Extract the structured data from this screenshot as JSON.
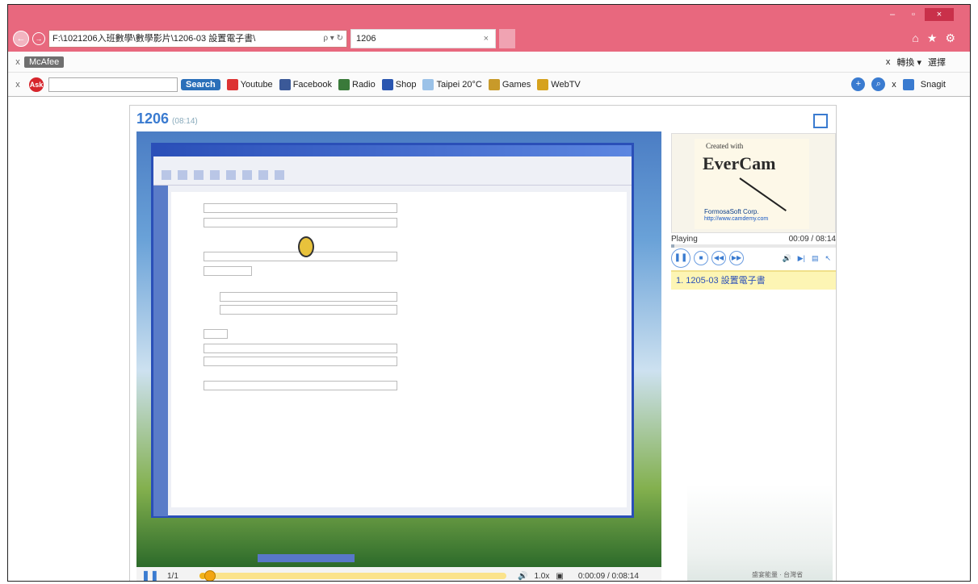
{
  "browser": {
    "address": "F:\\1021206入班數學\\數學影片\\1206-03 設置電子書\\",
    "address_tools": "ρ ▾ ↻",
    "tab_title": "1206",
    "tab_close": "×",
    "window": {
      "minimize": "–",
      "maximize": "▫",
      "close": "×"
    },
    "tools": {
      "home": "⌂",
      "favorites": "★",
      "settings": "⚙"
    }
  },
  "toolbar1": {
    "close": "x",
    "mcafee": "McAfee",
    "right_close": "x",
    "convert": "轉換 ▾",
    "select": "選擇"
  },
  "toolbar2": {
    "close": "x",
    "ask": "Ask",
    "search_button": "Search",
    "links": [
      "Youtube",
      "Facebook",
      "Radio",
      "Shop",
      "Taipei 20°C",
      "Games",
      "WebTV"
    ],
    "snagit": "Snagit",
    "right_close": "x"
  },
  "player": {
    "title": "1206",
    "duration": "(08:14)",
    "page_counter": "1/1",
    "progress_fraction": 0.02,
    "speed": "1.0x",
    "time": "0:00:09 / 0:08:14"
  },
  "side_panel": {
    "created_with": "Created with",
    "brand": "EverCam",
    "corp": "FormosaSoft Corp.",
    "url": "http://www.camdemy.com",
    "status": "Playing",
    "time": "00:09 / 08:14",
    "toc_item": "1. 1205-03 設置電子書",
    "footer": "盛宴能量 · 台灣省"
  },
  "colors": {
    "accent": "#3a7bd0",
    "titlebar": "#e8687e",
    "progress": "#f0b31c"
  }
}
